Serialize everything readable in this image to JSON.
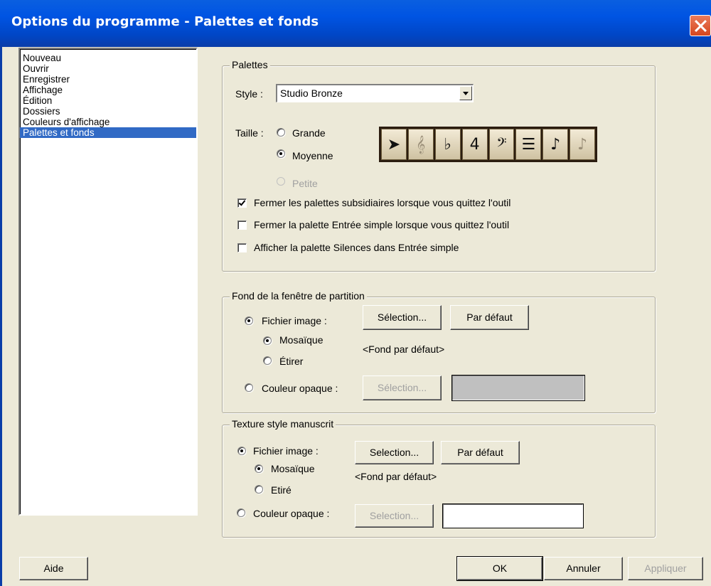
{
  "window": {
    "title": "Options du programme - Palettes et fonds"
  },
  "categories": [
    "Nouveau",
    "Ouvrir",
    "Enregistrer",
    "Affichage",
    "Édition",
    "Dossiers",
    "Couleurs d'affichage",
    "Palettes et fonds"
  ],
  "selected_category": "Palettes et fonds",
  "palettes": {
    "legend": "Palettes",
    "style_label": "Style :",
    "style_value": "Studio Bronze",
    "size_label": "Taille :",
    "size_options": [
      "Grande",
      "Moyenne",
      "Petite"
    ],
    "size_selected": "Moyenne",
    "preview_tools": [
      {
        "name": "pointer-tool-icon",
        "glyph": "➤"
      },
      {
        "name": "treble-clef-tool-icon",
        "glyph": "𝄞"
      },
      {
        "name": "key-signature-tool-icon",
        "glyph": "♭"
      },
      {
        "name": "time-signature-tool-icon",
        "glyph": "4"
      },
      {
        "name": "bass-clef-tool-icon",
        "glyph": "𝄢"
      },
      {
        "name": "staff-tool-icon",
        "glyph": "☰"
      },
      {
        "name": "note-tool-icon",
        "glyph": "♪"
      },
      {
        "name": "tuplet-tool-icon",
        "glyph": "♪"
      }
    ],
    "checkboxes": [
      {
        "label": "Fermer les palettes subsidiaires lorsque vous quittez l'outil",
        "checked": true
      },
      {
        "label": "Fermer la palette Entrée simple lorsque vous quittez l'outil",
        "checked": false
      },
      {
        "label": "Afficher la palette Silences dans Entrée simple",
        "checked": false
      }
    ]
  },
  "score_background": {
    "legend": "Fond de la fenêtre de partition",
    "image_file_label": "Fichier image :",
    "tile_label": "Mosaïque",
    "stretch_label": "Étirer",
    "select_button": "Sélection...",
    "default_button": "Par défaut",
    "current_file": "<Fond par défaut>",
    "solid_color_label": "Couleur opaque :",
    "solid_select_button": "Sélection...",
    "solid_color": "#c0c0c0"
  },
  "manuscript_texture": {
    "legend": "Texture style manuscrit",
    "image_file_label": "Fichier image :",
    "tile_label": "Mosaïque",
    "stretch_label": "Etiré",
    "select_button": "Selection...",
    "default_button": "Par défaut",
    "current_file": "<Fond par défaut>",
    "solid_color_label": "Couleur opaque :",
    "solid_select_button": "Selection...",
    "solid_color": "#ffffff"
  },
  "footer": {
    "help": "Aide",
    "ok": "OK",
    "cancel": "Annuler",
    "apply": "Appliquer"
  },
  "colors": {
    "titlebar": "#0054e3",
    "selection": "#316ac5",
    "dialog": "#ece9d8",
    "close": "#d6461e"
  }
}
